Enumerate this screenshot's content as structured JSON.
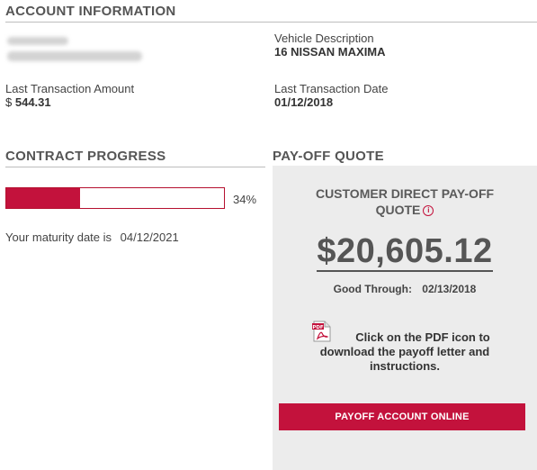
{
  "account_information": {
    "title": "ACCOUNT INFORMATION",
    "vehicle_description_label": "Vehicle Description",
    "vehicle_description_value": "16 NISSAN MAXIMA",
    "last_transaction_amount_label": "Last Transaction Amount",
    "last_transaction_amount_currency": "$",
    "last_transaction_amount_value": "544.31",
    "last_transaction_date_label": "Last Transaction Date",
    "last_transaction_date_value": "01/12/2018"
  },
  "contract_progress": {
    "title": "CONTRACT PROGRESS",
    "progress_percent": 34,
    "progress_label": "34%",
    "maturity_label": "Your maturity date is",
    "maturity_date": "04/12/2021"
  },
  "payoff_quote": {
    "title": "PAY-OFF QUOTE",
    "heading_line1": "CUSTOMER DIRECT PAY-OFF",
    "heading_line2": "QUOTE",
    "info_icon": "info-circle-icon",
    "amount": "$20,605.12",
    "good_through_label": "Good Through:",
    "good_through_date": "02/13/2018",
    "pdf_icon": "pdf-file-icon",
    "pdf_instructions": "Click on the PDF icon to download the payoff letter and instructions.",
    "payoff_button_label": "PAYOFF ACCOUNT ONLINE"
  },
  "colors": {
    "accent": "#c3123c",
    "panel_background": "#ececec",
    "heading_gray": "#555555"
  }
}
